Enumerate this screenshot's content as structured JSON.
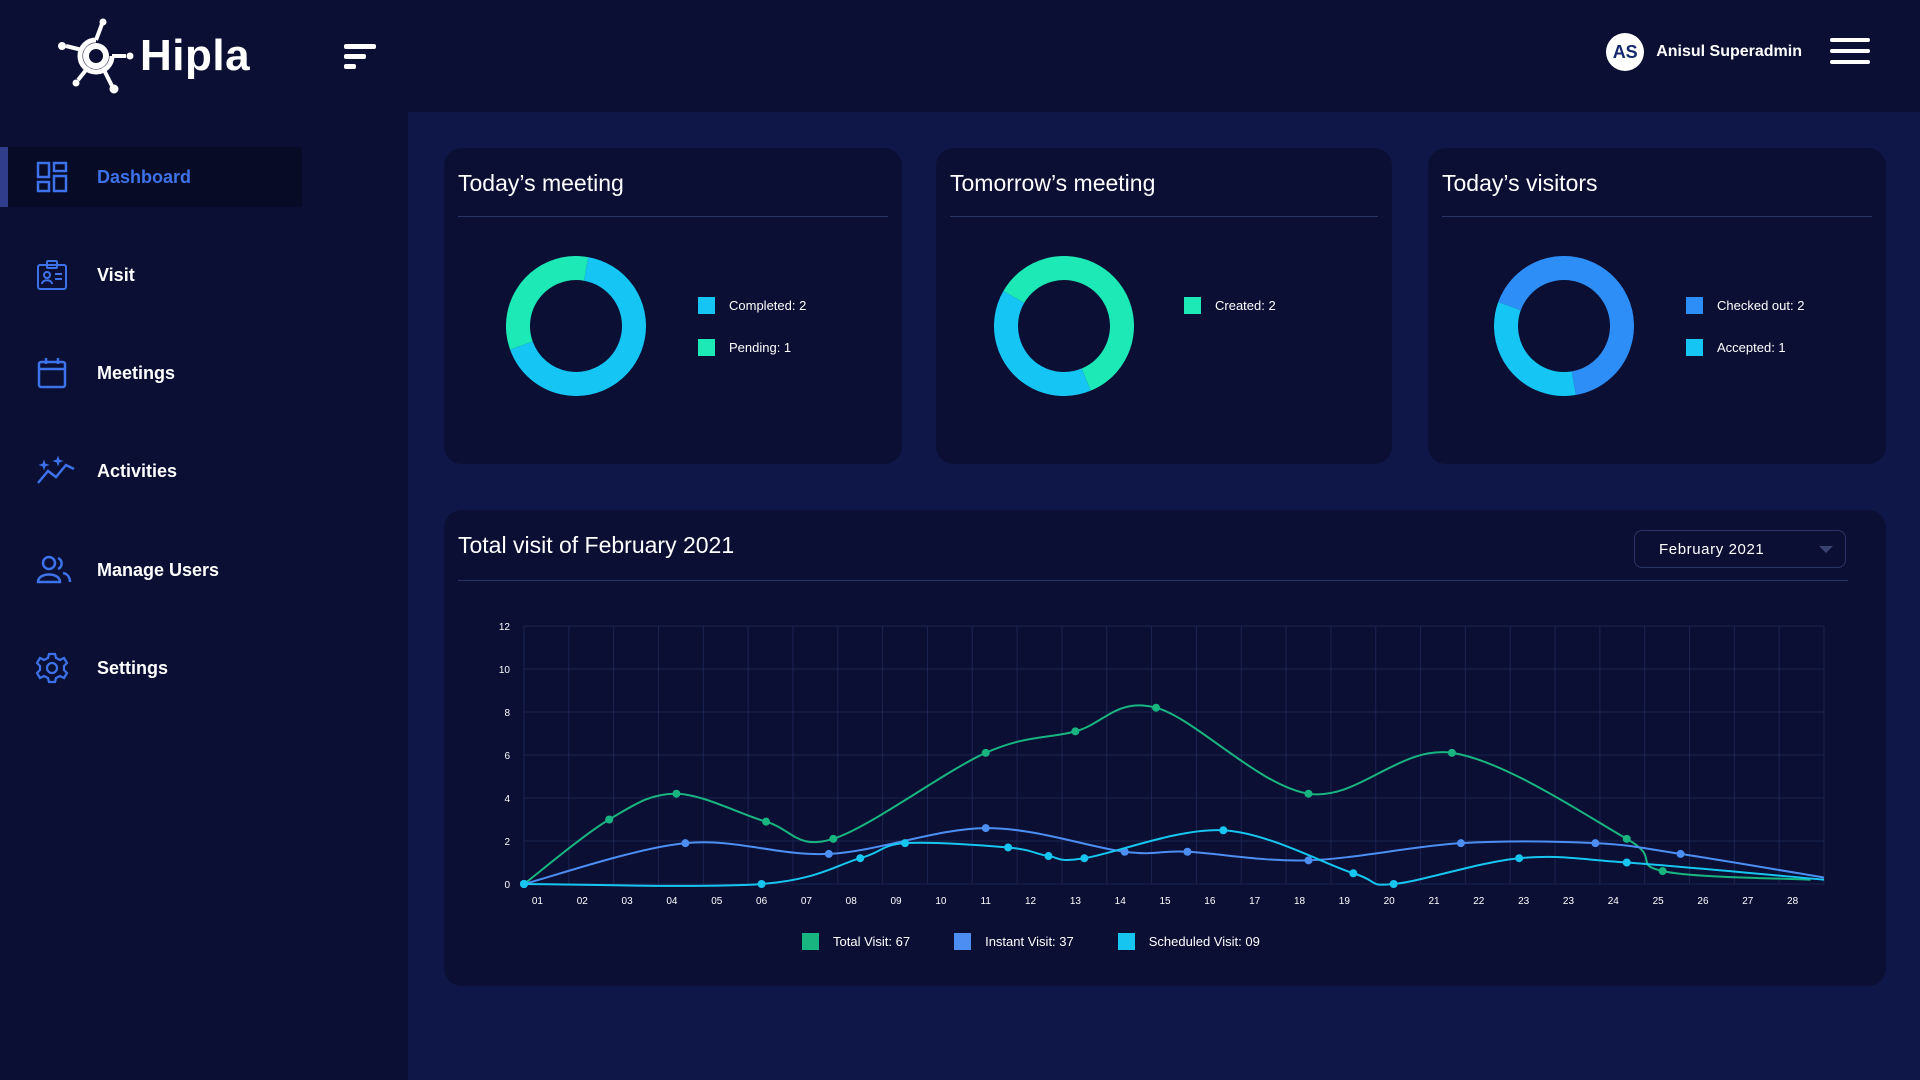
{
  "app": {
    "name": "Hipla"
  },
  "user": {
    "initials": "AS",
    "name": "Anisul Superadmin"
  },
  "sidebar": {
    "items": [
      {
        "label": "Dashboard",
        "icon": "dashboard-icon",
        "active": true
      },
      {
        "label": "Visit",
        "icon": "visit-id-card-icon",
        "active": false
      },
      {
        "label": "Meetings",
        "icon": "calendar-icon",
        "active": false
      },
      {
        "label": "Activities",
        "icon": "activity-chart-icon",
        "active": false
      },
      {
        "label": "Manage Users",
        "icon": "users-icon",
        "active": false
      },
      {
        "label": "Settings",
        "icon": "gear-icon",
        "active": false
      }
    ]
  },
  "colors": {
    "green": "#1de9b6",
    "cyan": "#15c5f4",
    "blue": "#2e8ef7",
    "total_line": "#19b581",
    "instant_line": "#4c8ef2",
    "scheduled_line": "#17c6f0"
  },
  "cards": {
    "todays_meeting": {
      "title": "Today’s meeting",
      "legend": [
        "Completed: 2",
        "Pending: 1"
      ],
      "values": [
        2,
        1
      ]
    },
    "tomorrows_meeting": {
      "title": "Tomorrow’s meeting",
      "legend": [
        "Created: 2"
      ],
      "values": [
        2
      ]
    },
    "todays_visitors": {
      "title": "Today’s visitors",
      "legend": [
        "Checked out: 2",
        "Accepted: 1"
      ],
      "values": [
        2,
        1
      ]
    }
  },
  "visit_chart": {
    "title": "Total visit of February 2021",
    "selected_month": "February 2021",
    "legend": {
      "total": "Total Visit: 67",
      "instant": "Instant Visit: 37",
      "scheduled": "Scheduled  Visit: 09"
    }
  },
  "chart_data": {
    "type": "line",
    "x": [
      "01",
      "02",
      "03",
      "04",
      "05",
      "06",
      "07",
      "08",
      "09",
      "10",
      "11",
      "12",
      "13",
      "14",
      "15",
      "16",
      "17",
      "18",
      "19",
      "20",
      "21",
      "22",
      "23",
      "23",
      "24",
      "25",
      "26",
      "27",
      "28"
    ],
    "y_ticks": [
      0,
      2,
      4,
      6,
      8,
      10,
      12
    ],
    "ylim": [
      0,
      12
    ],
    "grid": true,
    "series": [
      {
        "name": "Total Visit",
        "points": [
          [
            0,
            0
          ],
          [
            1.9,
            3
          ],
          [
            3.4,
            4.2
          ],
          [
            5.4,
            2.9
          ],
          [
            6.9,
            2.1
          ],
          [
            10.3,
            6.1
          ],
          [
            12.3,
            7.1
          ],
          [
            14.1,
            8.2
          ],
          [
            17.5,
            4.2
          ],
          [
            20.7,
            6.1
          ],
          [
            24.6,
            2.1
          ],
          [
            25.4,
            0.6
          ],
          [
            28.7,
            0.2
          ]
        ]
      },
      {
        "name": "Instant Visit",
        "points": [
          [
            0,
            0
          ],
          [
            3.6,
            1.9
          ],
          [
            6.8,
            1.4
          ],
          [
            10.3,
            2.6
          ],
          [
            13.4,
            1.5
          ],
          [
            14.8,
            1.5
          ],
          [
            17.5,
            1.1
          ],
          [
            20.9,
            1.9
          ],
          [
            23.9,
            1.9
          ],
          [
            25.8,
            1.4
          ],
          [
            29,
            0.3
          ]
        ]
      },
      {
        "name": "Scheduled Visit",
        "points": [
          [
            0,
            0
          ],
          [
            5.3,
            0
          ],
          [
            7.5,
            1.2
          ],
          [
            8.5,
            1.9
          ],
          [
            10.8,
            1.7
          ],
          [
            11.7,
            1.3
          ],
          [
            12.5,
            1.2
          ],
          [
            15.6,
            2.5
          ],
          [
            18.5,
            0.5
          ],
          [
            19.4,
            0
          ],
          [
            22.2,
            1.2
          ],
          [
            24.6,
            1
          ],
          [
            29,
            0.2
          ]
        ]
      }
    ]
  }
}
